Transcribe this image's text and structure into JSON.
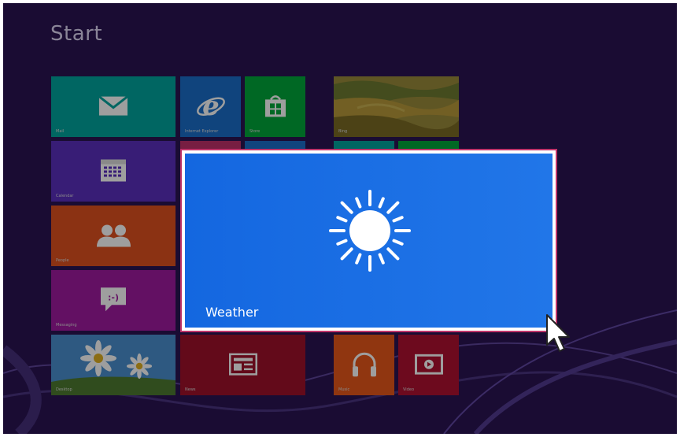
{
  "screen": {
    "title": "Start"
  },
  "tiles": {
    "mail": {
      "label": "Mail",
      "color": "#00a59e"
    },
    "ie": {
      "label": "Internet Explorer",
      "color": "#1a6ec9"
    },
    "store": {
      "label": "Store",
      "color": "#00a83a"
    },
    "bing": {
      "label": "Bing"
    },
    "calendar": {
      "label": "Calendar",
      "color": "#5a2ebf"
    },
    "people": {
      "label": "People",
      "color": "#e0501e"
    },
    "messaging": {
      "label": "Messaging",
      "color": "#a01aa0"
    },
    "desktop": {
      "label": "Desktop"
    },
    "news": {
      "label": "News",
      "color": "#a0102a"
    },
    "music": {
      "label": "Music",
      "color": "#e8571a"
    },
    "video": {
      "label": "Video",
      "color": "#b01030"
    }
  },
  "weather": {
    "label": "Weather",
    "icon": "sun-icon",
    "highlight_color": "#c0356a"
  },
  "cursor": {
    "icon": "mouse-pointer-icon"
  }
}
